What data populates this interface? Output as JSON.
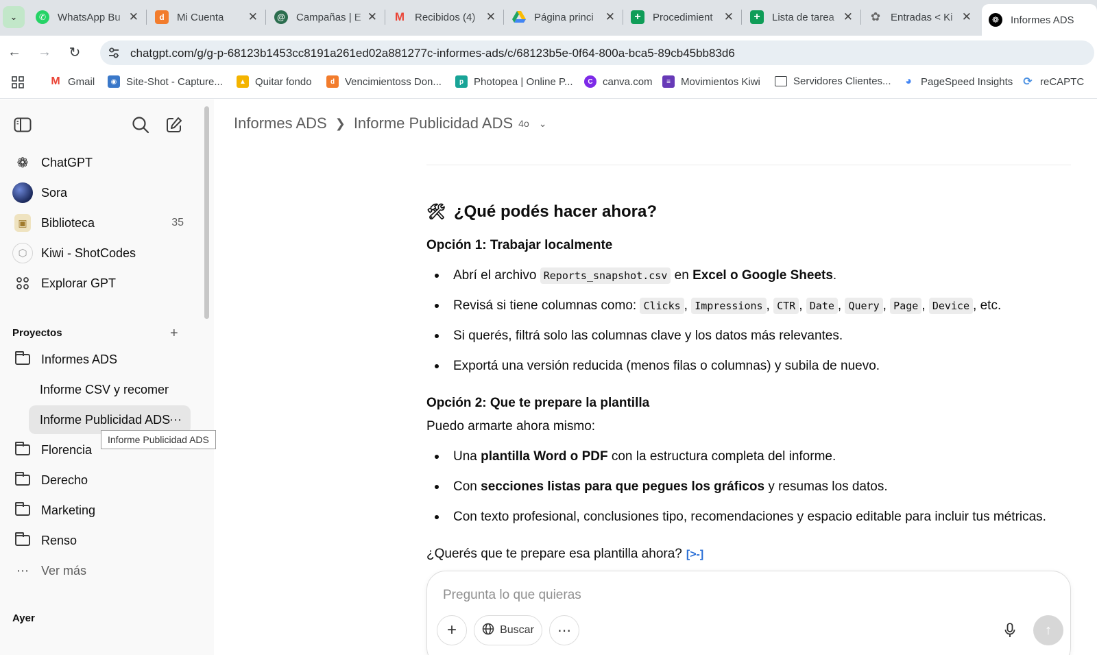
{
  "browser": {
    "tabs": [
      {
        "title": "WhatsApp Bu",
        "icon": "whatsapp-icon",
        "color": "#25d366"
      },
      {
        "title": "Mi Cuenta",
        "icon": "d-icon",
        "color": "#f27c2c"
      },
      {
        "title": "Campañas | E",
        "icon": "campaign-icon",
        "color": "#2b6d4e"
      },
      {
        "title": "Recibidos (4)",
        "icon": "gmail-icon",
        "color": "#ea4335"
      },
      {
        "title": "Página princi",
        "icon": "drive-icon",
        "color": "#1fa463"
      },
      {
        "title": "Procedimient",
        "icon": "sheets-icon",
        "color": "#0f9d58"
      },
      {
        "title": "Lista de tarea",
        "icon": "sheets-icon",
        "color": "#0f9d58"
      },
      {
        "title": "Entradas < Ki",
        "icon": "wordpress-icon",
        "color": "#666666"
      },
      {
        "title": "Informes ADS",
        "icon": "chatgpt-icon",
        "color": "#000000"
      }
    ],
    "url": "chatgpt.com/g/g-p-68123b1453cc8191a261ed02a881277c-informes-ads/c/68123b5e-0f64-800a-bca5-89cb45bb83d6",
    "bookmarks": [
      {
        "label": "Gmail",
        "icon": "gmail-icon",
        "color": "#ea4335"
      },
      {
        "label": "Site-Shot - Capture...",
        "icon": "camera-icon",
        "color": "#3a78c9"
      },
      {
        "label": "Quitar fondo",
        "icon": "hat-icon",
        "color": "#f4b400"
      },
      {
        "label": "Vencimientoss Don...",
        "icon": "d-icon",
        "color": "#f27c2c"
      },
      {
        "label": "Photopea | Online P...",
        "icon": "photopea-icon",
        "color": "#18a497"
      },
      {
        "label": "canva.com",
        "icon": "canva-icon",
        "color": "#7d2ae8"
      },
      {
        "label": "Movimientos Kiwi",
        "icon": "forms-icon",
        "color": "#673ab7"
      },
      {
        "label": "Servidores Clientes...",
        "icon": "folder-icon",
        "color": "#3c4043"
      },
      {
        "label": "PageSpeed Insights",
        "icon": "pagespeed-icon",
        "color": "#4285f4"
      },
      {
        "label": "reCAPTC",
        "icon": "recaptcha-icon",
        "color": "#4a90e2"
      }
    ]
  },
  "sidebar": {
    "nav": [
      {
        "label": "ChatGPT",
        "icon": "chatgpt-icon"
      },
      {
        "label": "Sora",
        "icon": "sora-icon"
      },
      {
        "label": "Biblioteca",
        "icon": "library-icon",
        "count": "35"
      },
      {
        "label": "Kiwi - ShotCodes",
        "icon": "gpt-icon"
      },
      {
        "label": "Explorar GPT",
        "icon": "grid-icon"
      }
    ],
    "projects_title": "Proyectos",
    "projects": [
      {
        "label": "Informes ADS"
      },
      {
        "label": "Florencia"
      },
      {
        "label": "Derecho"
      },
      {
        "label": "Marketing"
      },
      {
        "label": "Renso"
      }
    ],
    "chats": [
      {
        "label": "Informe CSV y recomendaciones"
      },
      {
        "label": "Informe Publicidad ADS"
      }
    ],
    "tooltip": "Informe Publicidad ADS",
    "more": "Ver más",
    "yesterday": "Ayer"
  },
  "header": {
    "project": "Informes ADS",
    "chat": "Informe Publicidad ADS",
    "model": "4o"
  },
  "message": {
    "heading": "¿Qué podés hacer ahora?",
    "opt1_title": "Opción 1: Trabajar localmente",
    "opt1_b1_pre": "Abrí el archivo",
    "opt1_b1_code": "Reports_snapshot.csv",
    "opt1_b1_mid": "en",
    "opt1_b1_bold": "Excel o Google Sheets",
    "opt1_b1_end": ".",
    "opt1_b2_pre": "Revisá si tiene columnas como:",
    "opt1_b2_codes": [
      "Clicks",
      "Impressions",
      "CTR",
      "Date",
      "Query",
      "Page",
      "Device"
    ],
    "opt1_b2_end": ", etc.",
    "opt1_b3": "Si querés, filtrá solo las columnas clave y los datos más relevantes.",
    "opt1_b4": "Exportá una versión reducida (menos filas o columnas) y subila de nuevo.",
    "opt2_title": "Opción 2: Que te prepare la plantilla",
    "opt2_intro": "Puedo armarte ahora mismo:",
    "opt2_b1_pre": "Una",
    "opt2_b1_bold": "plantilla Word o PDF",
    "opt2_b1_end": "con la estructura completa del informe.",
    "opt2_b2_pre": "Con",
    "opt2_b2_bold": "secciones listas para que pegues los gráficos",
    "opt2_b2_end": "y resumas los datos.",
    "opt2_b3": "Con texto profesional, conclusiones tipo, recomendaciones y espacio editable para incluir tus métricas.",
    "question": "¿Querés que te prepare esa plantilla ahora?"
  },
  "composer": {
    "placeholder": "Pregunta lo que quieras",
    "search_label": "Buscar"
  }
}
